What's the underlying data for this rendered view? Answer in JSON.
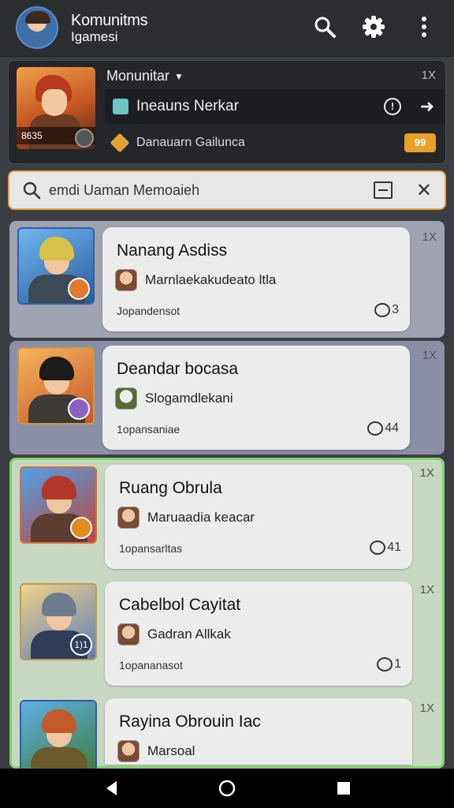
{
  "header": {
    "title": "Komunitms",
    "subtitle": "Igamesi",
    "search_icon": "search-icon",
    "settings_icon": "gear-icon",
    "more_icon": "more-vertical-icon"
  },
  "featured": {
    "title": "Monunitar",
    "count": "1X",
    "thumb_tag": "8635",
    "row1_text": "Ineauns Nerkar",
    "row2_text": "Danauarn Gailunca",
    "badge": "99"
  },
  "search": {
    "placeholder": "emdi Uaman Memoaieh"
  },
  "items": [
    {
      "title": "Nanang Asdiss",
      "author": "Marnlaekakudeato ltla",
      "meta": "Jopandensot",
      "comments": "3",
      "count": "1X"
    },
    {
      "title": "Deandar bocasa",
      "author": "Slogamdlekani",
      "meta": "1opansaniae",
      "comments": "44",
      "count": "1X"
    },
    {
      "title": "Ruang Obrula",
      "author": "Maruaadia keacar",
      "meta": "1opansarltas",
      "comments": "41",
      "count": "1X"
    },
    {
      "title": "Cabelbol Cayitat",
      "author": "Gadran Allkak",
      "meta": "1opananasot",
      "comments": "1",
      "count": "1X"
    },
    {
      "title": "Rayina Obrouin Iac",
      "author": "Marsoal",
      "meta": "",
      "comments": "",
      "count": "1X"
    }
  ],
  "item_levels": [
    "",
    "",
    "",
    "1)1",
    ""
  ],
  "colors": {
    "accent_orange": "#e8a34a",
    "green_highlight": "#7fd36a",
    "blue_frame": "#2f5fa6"
  }
}
